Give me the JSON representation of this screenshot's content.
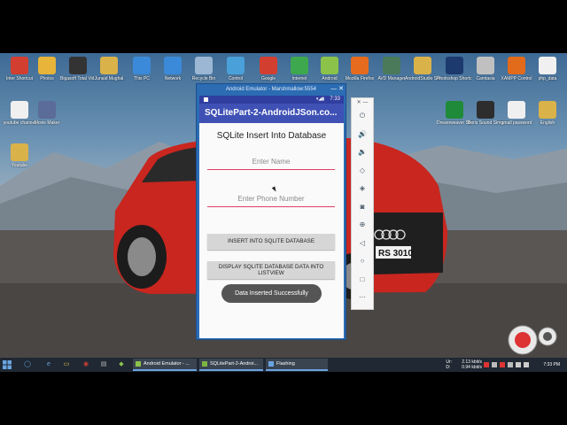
{
  "desktop": {
    "icons": [
      {
        "label": "Inter Shortcut",
        "color": "#d23f31"
      },
      {
        "label": "Photos",
        "color": "#e8b43a"
      },
      {
        "label": "Bigasoft Total Vid...",
        "color": "#333333"
      },
      {
        "label": "Junaid Mughal",
        "color": "#d9b24a"
      },
      {
        "label": "This PC",
        "color": "#3b8ad9"
      },
      {
        "label": "Network",
        "color": "#3b8ad9"
      },
      {
        "label": "Recycle Bin",
        "color": "#9bb7d4"
      },
      {
        "label": "Control",
        "color": "#4aa0d8"
      },
      {
        "label": "Google",
        "color": "#d23f31"
      },
      {
        "label": "Internet",
        "color": "#3ea84f"
      },
      {
        "label": "Android",
        "color": "#8bc34a"
      },
      {
        "label": "Mozilla Firefox",
        "color": "#e66b1f"
      },
      {
        "label": "AVD Manager",
        "color": "#4a7a5a"
      },
      {
        "label": "AndroidStudio Shortcut",
        "color": "#d9b24a"
      },
      {
        "label": "Photoshop Shortcut",
        "color": "#1c3a6e"
      },
      {
        "label": "Camtasia",
        "color": "#c0c0c0"
      },
      {
        "label": "XAMPP Control",
        "color": "#e26a1b"
      },
      {
        "label": "php_data",
        "color": "#f0f0f0"
      },
      {
        "label": "youtube channel",
        "color": "#f0f0f0"
      },
      {
        "label": "Movie Maker",
        "color": "#5b6b9a"
      },
      {
        "label": "Dreamweaver Shortcut",
        "color": "#1f8a3a"
      },
      {
        "label": "Boris Sound Simulator",
        "color": "#2d2d2d"
      },
      {
        "label": "gmail password",
        "color": "#f0f0f0"
      },
      {
        "label": "English",
        "color": "#d9b24a"
      },
      {
        "label": "Youtube",
        "color": "#d9b24a"
      }
    ]
  },
  "emulator": {
    "window_title": "Android Emulator - Marshmallow:5554",
    "controls": "— ✕",
    "status_time": "7:33",
    "status_icons": "▾◢▮",
    "app_title": "SQLitePart-2-AndroidJSon.co...",
    "heading": "SQLite Insert Into Database",
    "name_placeholder": "Enter Name",
    "phone_placeholder": "Enter Phone Number",
    "insert_button": "INSERT INTO SQLITE DATABASE",
    "display_button": "DISPLAY SQLITE DATABASE DATA INTO LISTVIEW",
    "toast": "Data Inserted Successfully"
  },
  "toolbar": {
    "top": "✕ —",
    "buttons": [
      {
        "name": "power-icon",
        "glyph": "⏻"
      },
      {
        "name": "volume-up-icon",
        "glyph": "🔊"
      },
      {
        "name": "volume-down-icon",
        "glyph": "🔉"
      },
      {
        "name": "rotate-left-icon",
        "glyph": "◇"
      },
      {
        "name": "rotate-right-icon",
        "glyph": "◈"
      },
      {
        "name": "camera-icon",
        "glyph": "◙"
      },
      {
        "name": "zoom-icon",
        "glyph": "⊕"
      },
      {
        "name": "back-icon",
        "glyph": "◁"
      },
      {
        "name": "home-icon",
        "glyph": "○"
      },
      {
        "name": "overview-icon",
        "glyph": "□"
      },
      {
        "name": "more-icon",
        "glyph": "⋯"
      }
    ]
  },
  "taskbar": {
    "tasks": [
      {
        "label": "Android Emulator - ...",
        "color": "#8bc34a"
      },
      {
        "label": "SQLitePart-2-Androi...",
        "color": "#7cb342"
      },
      {
        "label": "Flashing",
        "color": "#6aa3e0"
      }
    ],
    "tray": {
      "up_label": "Ur:",
      "down_label": "D:",
      "up_speed": "2.13 kbit/s",
      "down_speed": "0.94 kbit/s",
      "clock": "7:33 PM"
    }
  }
}
